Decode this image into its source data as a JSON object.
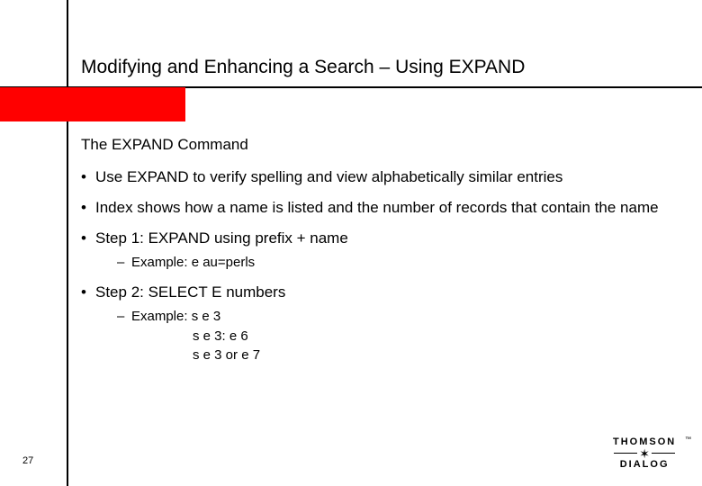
{
  "title": "Modifying and Enhancing a Search – Using EXPAND",
  "subtitle": "The EXPAND Command",
  "bullets": {
    "b0": "Use EXPAND to verify spelling and view alphabetically similar entries",
    "b1": "Index shows how a name is listed and the number of records that contain the name",
    "b2": "Step 1:  EXPAND using prefix + name",
    "b2_sub": "Example:  e au=perls",
    "b3": "Step 2:  SELECT E numbers",
    "b3_sub": "Example: s e 3",
    "b3_ex2": "s e 3: e 6",
    "b3_ex3": "s e 3 or e 7"
  },
  "page_number": "27",
  "logo": {
    "top": "THOMSON",
    "bottom": "DIALOG"
  }
}
